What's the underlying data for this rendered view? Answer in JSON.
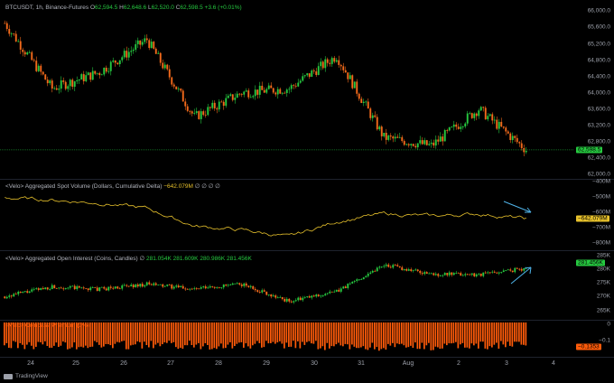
{
  "price_pane": {
    "legend": {
      "symbol": "BTCUSDT, 1h, Binance-Futures",
      "open_label": "O",
      "open": "62,594.5",
      "high_label": "H",
      "high": "62,648.6",
      "low_label": "L",
      "low": "62,520.0",
      "close_label": "C",
      "close": "62,598.5",
      "change": "+3.6 (+0.01%)"
    },
    "price_axis": [
      "66,000.0",
      "65,600.0",
      "65,200.0",
      "64,800.0",
      "64,400.0",
      "64,000.0",
      "63,600.0",
      "63,200.0",
      "62,800.0",
      "62,400.0",
      "62,000.0"
    ],
    "last_price_tag": "62,598.5",
    "colors": {
      "up": "#26c940",
      "down": "#f2691b",
      "last_line": "#26c940"
    }
  },
  "volume_pane": {
    "legend": {
      "title": "<Velo> Aggregated Spot Volume (Dollars, Cumulative Delta)",
      "value": "−642.079M",
      "extra": "∅ ∅ ∅ ∅"
    },
    "axis": [
      "−400M",
      "−500M",
      "−600M",
      "−700M",
      "−800M"
    ],
    "tag": "−642.079M",
    "color": "#e8c22c",
    "arrow_color": "#4fb3e8"
  },
  "oi_pane": {
    "legend": {
      "title": "<Velo> Aggregated Open Interest (Coins, Candles)",
      "sym": "∅",
      "o": "281.054K",
      "h": "281.609K",
      "l": "280.986K",
      "c": "281.456K"
    },
    "axis": [
      "285K",
      "280K",
      "275K",
      "270K",
      "265K"
    ],
    "tag": "281.456K"
  },
  "premium_pane": {
    "legend": {
      "title": "<Velo> Coinbase Premium (0%)"
    },
    "axis": [
      "0",
      "−0.1",
      "−0.1353"
    ],
    "tag": "−0.1353",
    "color": "#ff5b0a"
  },
  "x_axis": [
    "24",
    "25",
    "26",
    "27",
    "28",
    "29",
    "30",
    "31",
    "Aug",
    "2",
    "3",
    "4"
  ],
  "footer": {
    "brand": "TradingView"
  },
  "chart_data": [
    {
      "type": "line",
      "title": "BTCUSDT, 1h, Binance-Futures",
      "x": [
        "24",
        "25",
        "26",
        "27",
        "28",
        "29",
        "30",
        "31",
        "Aug",
        "2",
        "3"
      ],
      "series": [
        {
          "values": [
            65700,
            64100,
            64500,
            65300,
            63400,
            64000,
            64100,
            64900,
            62900,
            62700,
            63600,
            62600
          ]
        }
      ],
      "ylim": [
        62000,
        66000
      ]
    },
    {
      "type": "line",
      "title": "<Velo> Aggregated Spot Volume (Dollars, Cumulative Delta)",
      "x": [
        "24",
        "25",
        "26",
        "27",
        "28",
        "29",
        "30",
        "31",
        "Aug",
        "2",
        "3"
      ],
      "series": [
        {
          "values": [
            -505,
            -520,
            -540,
            -575,
            -690,
            -715,
            -760,
            -660,
            -610,
            -625,
            -610,
            -642.079
          ]
        }
      ],
      "ylim": [
        -800,
        -400
      ]
    },
    {
      "type": "line",
      "title": "<Velo> Aggregated Open Interest (Coins, Candles)",
      "x": [
        "24",
        "25",
        "26",
        "27",
        "28",
        "29",
        "30",
        "31",
        "Aug",
        "2",
        "3"
      ],
      "series": [
        {
          "values": [
            270,
            274,
            273,
            275,
            273,
            275,
            268,
            272,
            283,
            279,
            279,
            281.456
          ]
        }
      ],
      "ylim": [
        265,
        285
      ]
    }
  ]
}
